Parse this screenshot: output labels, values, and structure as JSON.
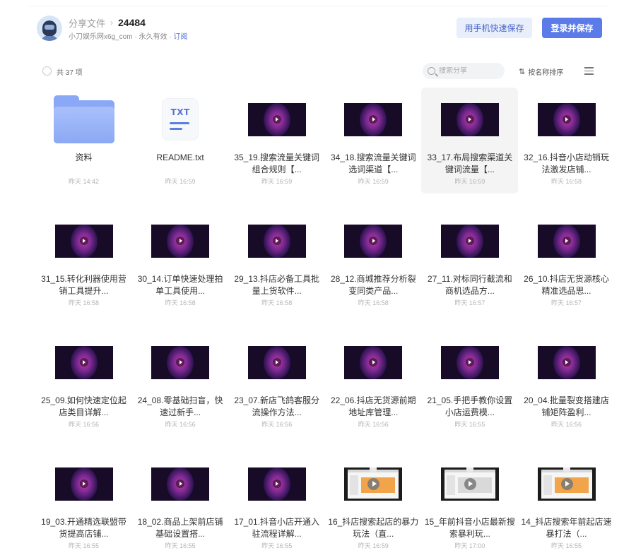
{
  "header": {
    "breadcrumb_root": "分享文件",
    "breadcrumb_sep": "›",
    "breadcrumb_current": "24484",
    "sharer": "小刀娱乐网x6g_com",
    "dot": "·",
    "validity": "永久有效",
    "subscribe": "订阅",
    "save_by_phone": "用手机快速保存",
    "login_and_save": "登录并保存"
  },
  "toolbar": {
    "count": "共 37 项",
    "search_placeholder": "搜索分享",
    "sort_label": "按名称排序"
  },
  "files": [
    {
      "type": "folder",
      "name": "资料",
      "time": "昨天 14:42"
    },
    {
      "type": "txt",
      "name": "README.txt",
      "time": "昨天 16:59"
    },
    {
      "type": "video",
      "name": "35_19.搜索流量关键词组合规则【...",
      "time": "昨天 16:59"
    },
    {
      "type": "video",
      "name": "34_18.搜索流量关键词选词渠道【...",
      "time": "昨天 16:59"
    },
    {
      "type": "video",
      "name": "33_17.布局搜索渠道关键词流量【...",
      "time": "昨天 16:59",
      "selected": true
    },
    {
      "type": "video",
      "name": "32_16.抖音小店动销玩法激发店铺...",
      "time": "昨天 16:58"
    },
    {
      "type": "video",
      "name": "31_15.转化利器使用营销工具提升...",
      "time": "昨天 16:58"
    },
    {
      "type": "video",
      "name": "30_14.订单快速处理拍单工具使用...",
      "time": "昨天 16:58"
    },
    {
      "type": "video",
      "name": "29_13.抖店必备工具批量上货软件...",
      "time": "昨天 16:58"
    },
    {
      "type": "video",
      "name": "28_12.商城推荐分析裂变同类产品...",
      "time": "昨天 16:58"
    },
    {
      "type": "video",
      "name": "27_11.对标同行截流和商机选品方...",
      "time": "昨天 16:57"
    },
    {
      "type": "video",
      "name": "26_10.抖店无货源核心精准选品思...",
      "time": "昨天 16:57"
    },
    {
      "type": "video",
      "name": "25_09.如何快速定位起店类目详解...",
      "time": "昨天 16:56"
    },
    {
      "type": "video",
      "name": "24_08.零基础扫盲，快速过新手...",
      "time": "昨天 16:56"
    },
    {
      "type": "video",
      "name": "23_07.新店飞鸽客服分流操作方法...",
      "time": "昨天 16:56"
    },
    {
      "type": "video",
      "name": "22_06.抖店无货源前期地址库管理...",
      "time": "昨天 16:56"
    },
    {
      "type": "video",
      "name": "21_05.手把手教你设置小店运费模...",
      "time": "昨天 16:55"
    },
    {
      "type": "video",
      "name": "20_04.批量裂变搭建店铺矩阵盈利...",
      "time": "昨天 16:56"
    },
    {
      "type": "video",
      "name": "19_03.开通精选联盟带货提高店铺...",
      "time": "昨天 16:55"
    },
    {
      "type": "video",
      "name": "18_02.商品上架前店铺基础设置搭...",
      "time": "昨天 16:55"
    },
    {
      "type": "video",
      "name": "17_01.抖音小店开通入驻流程详解...",
      "time": "昨天 16:55"
    },
    {
      "type": "screen",
      "variant": "orange",
      "name": "16_抖店搜索起店的暴力玩法（直...",
      "time": "昨天 16:59"
    },
    {
      "type": "screen",
      "variant": "gray",
      "name": "15_年前抖音小店最新搜索暴利玩...",
      "time": "昨天 17:00"
    },
    {
      "type": "screen",
      "variant": "orange",
      "name": "14_抖店搜索年前起店速暴打法（...",
      "time": "昨天 16:55"
    }
  ],
  "colors": {
    "accent": "#5b7ce8",
    "phone_button_bg": "#e9eefb",
    "folder": "#8aa8f6",
    "selected_bg": "#f4f4f5"
  }
}
